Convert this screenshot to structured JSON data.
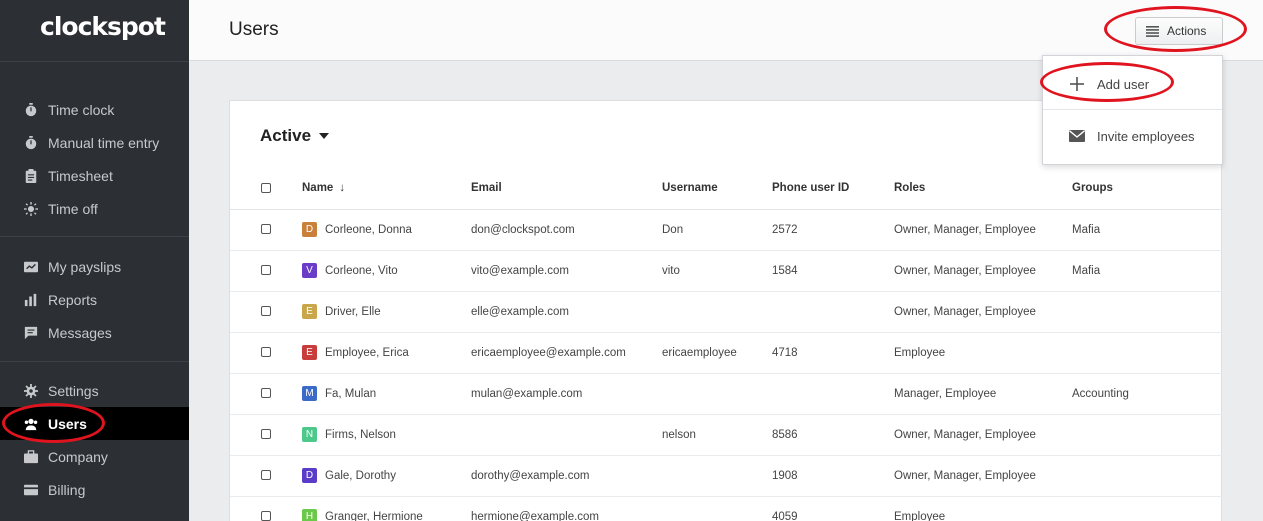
{
  "app": {
    "logo": "clockspot"
  },
  "sidebar": {
    "groups": [
      [
        {
          "label": "Time clock",
          "icon": "stopwatch-icon"
        },
        {
          "label": "Manual time entry",
          "icon": "stopwatch-icon"
        },
        {
          "label": "Timesheet",
          "icon": "clipboard-icon"
        },
        {
          "label": "Time off",
          "icon": "sun-icon"
        }
      ],
      [
        {
          "label": "My payslips",
          "icon": "payslip-icon"
        },
        {
          "label": "Reports",
          "icon": "bar-chart-icon"
        },
        {
          "label": "Messages",
          "icon": "chat-icon"
        }
      ],
      [
        {
          "label": "Settings",
          "icon": "gear-icon"
        },
        {
          "label": "Users",
          "icon": "users-icon",
          "active": true
        },
        {
          "label": "Company",
          "icon": "briefcase-icon"
        },
        {
          "label": "Billing",
          "icon": "credit-card-icon"
        }
      ]
    ]
  },
  "header": {
    "title": "Users",
    "actions_label": "Actions"
  },
  "actions_menu": {
    "items": [
      {
        "label": "Add user",
        "icon": "plus-icon"
      },
      {
        "label": "Invite employees",
        "icon": "envelope-icon"
      }
    ]
  },
  "users_table": {
    "filter_label": "Active",
    "columns": [
      "Name",
      "Email",
      "Username",
      "Phone user ID",
      "Roles",
      "Groups"
    ],
    "sort_indicator": "↓",
    "rows": [
      {
        "initial": "D",
        "color": "#c8803a",
        "name": "Corleone, Donna",
        "email": "don@clockspot.com",
        "username": "Don",
        "phone_id": "2572",
        "roles": "Owner, Manager, Employee",
        "groups": "Mafia"
      },
      {
        "initial": "V",
        "color": "#6a3cc8",
        "name": "Corleone, Vito",
        "email": "vito@example.com",
        "username": "vito",
        "phone_id": "1584",
        "roles": "Owner, Manager, Employee",
        "groups": "Mafia"
      },
      {
        "initial": "E",
        "color": "#c9a64a",
        "name": "Driver, Elle",
        "email": "elle@example.com",
        "username": "",
        "phone_id": "",
        "roles": "Owner, Manager, Employee",
        "groups": ""
      },
      {
        "initial": "E",
        "color": "#c83c3c",
        "name": "Employee, Erica",
        "email": "ericaemployee@example.com",
        "username": "ericaemployee",
        "phone_id": "4718",
        "roles": "Employee",
        "groups": ""
      },
      {
        "initial": "M",
        "color": "#3c6ac8",
        "name": "Fa, Mulan",
        "email": "mulan@example.com",
        "username": "",
        "phone_id": "",
        "roles": "Manager, Employee",
        "groups": "Accounting"
      },
      {
        "initial": "N",
        "color": "#4cc88a",
        "name": "Firms, Nelson",
        "email": "",
        "username": "nelson",
        "phone_id": "8586",
        "roles": "Owner, Manager, Employee",
        "groups": ""
      },
      {
        "initial": "D",
        "color": "#5a3cc8",
        "name": "Gale, Dorothy",
        "email": "dorothy@example.com",
        "username": "",
        "phone_id": "1908",
        "roles": "Owner, Manager, Employee",
        "groups": ""
      },
      {
        "initial": "H",
        "color": "#6ac84a",
        "name": "Granger, Hermione",
        "email": "hermione@example.com",
        "username": "",
        "phone_id": "4059",
        "roles": "Employee",
        "groups": ""
      }
    ]
  },
  "annotation_color": "#e0141e"
}
